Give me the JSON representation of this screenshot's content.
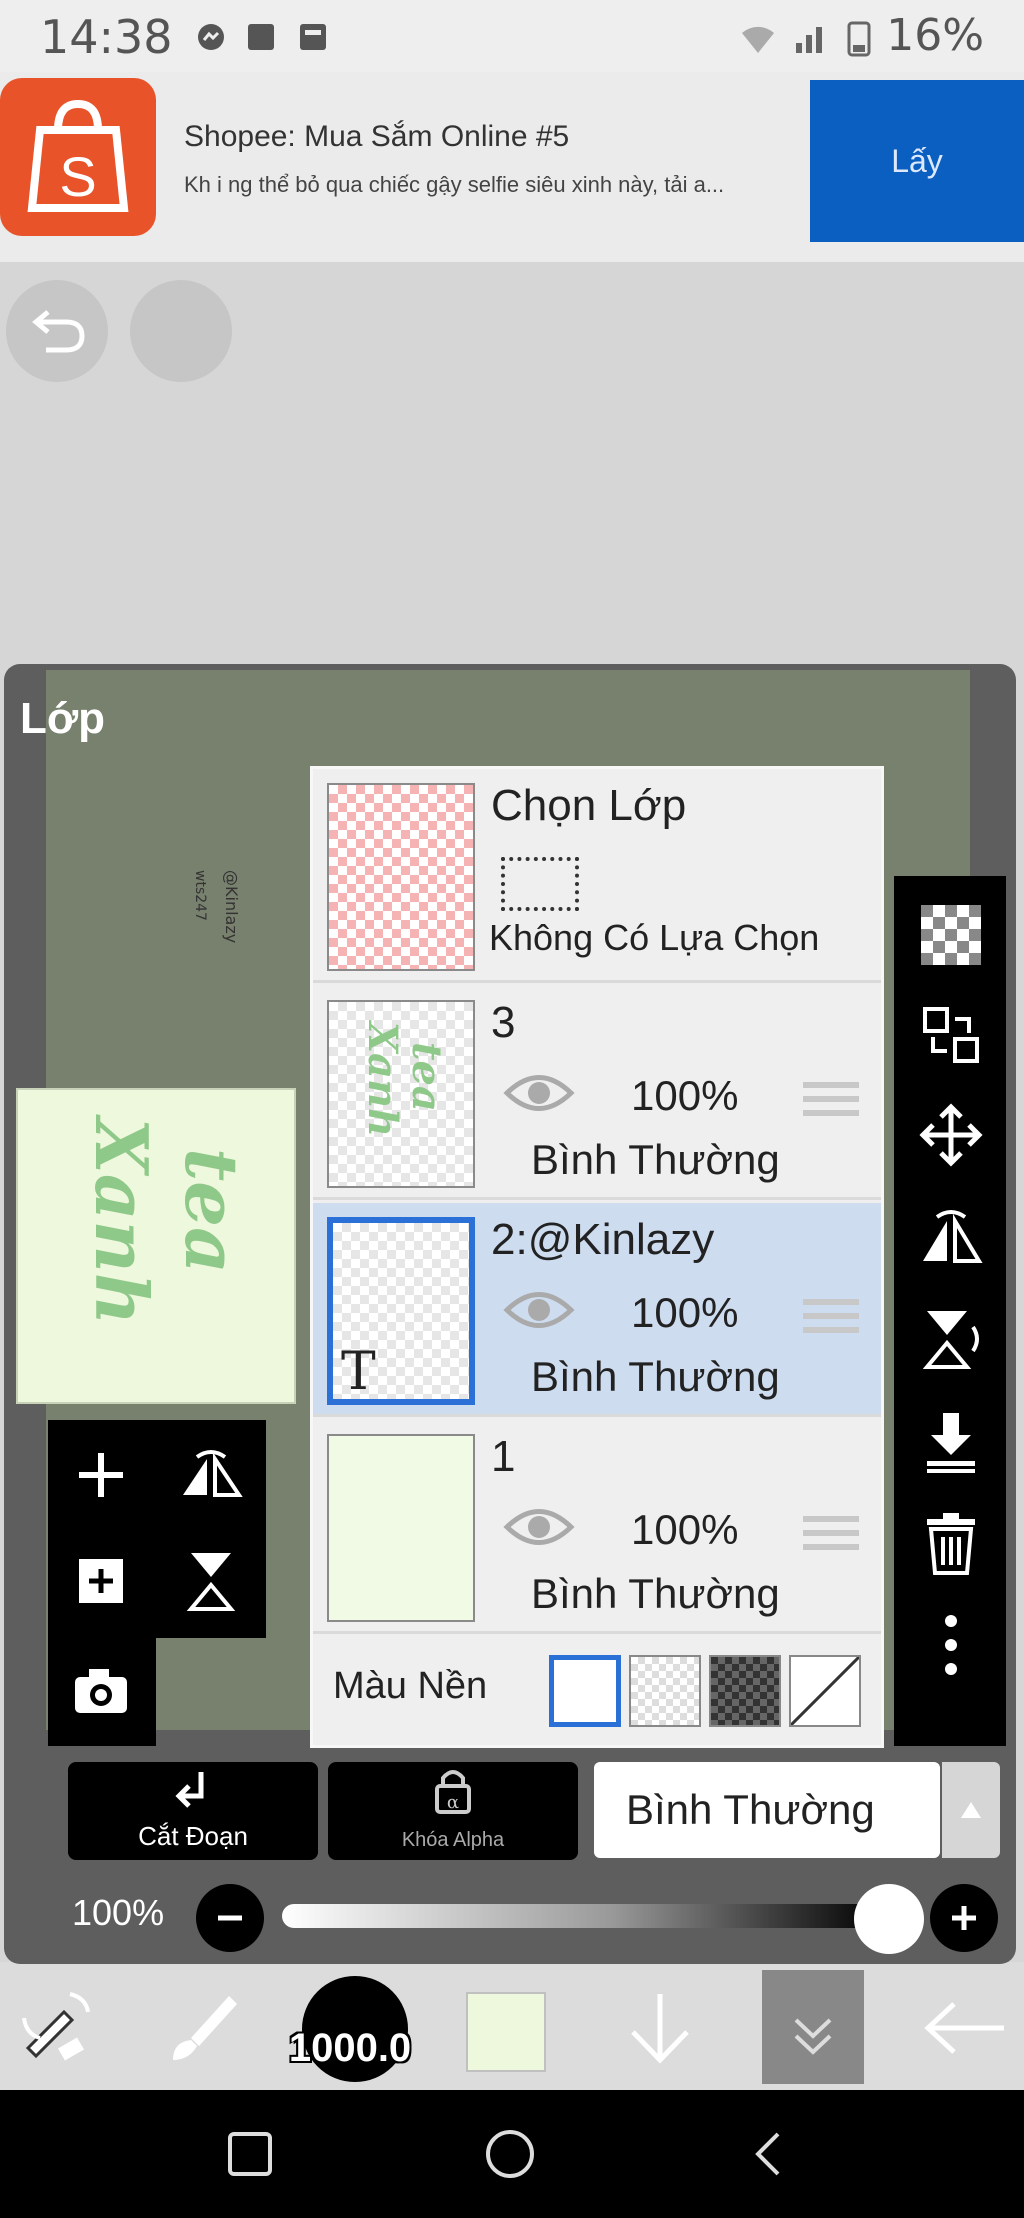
{
  "status_bar": {
    "time": "14:38",
    "battery": "16%"
  },
  "ad": {
    "title": "Shopee: Mua Sắm Online #5",
    "description": "Kh i ng thể bỏ qua chiếc gậy selfie siêu xinh này, tải a...",
    "button_label": "Lấy"
  },
  "panel": {
    "title": "Lớp"
  },
  "selection_layer": {
    "title": "Chọn Lớp",
    "status": "Không Có Lựa Chọn"
  },
  "layers": [
    {
      "name": "3",
      "opacity": "100%",
      "blend": "Bình Thường",
      "selected": false
    },
    {
      "name": "2:@Kinlazy",
      "opacity": "100%",
      "blend": "Bình Thường",
      "selected": true
    },
    {
      "name": "1",
      "opacity": "100%",
      "blend": "Bình Thường",
      "selected": false
    }
  ],
  "background_color": {
    "label": "Màu Nền"
  },
  "bottom_actions": {
    "clip_label": "Cắt Đoạn",
    "alpha_lock_label": "Khóa Alpha",
    "blend_mode": "Bình Thường"
  },
  "opacity": {
    "label": "100%",
    "value": 1.0
  },
  "toolbar": {
    "brush_size": "1000.0"
  },
  "colors": {
    "accent": "#2a70d6",
    "selected_row": "#cedcf0",
    "current_color": "#eef8dc"
  }
}
